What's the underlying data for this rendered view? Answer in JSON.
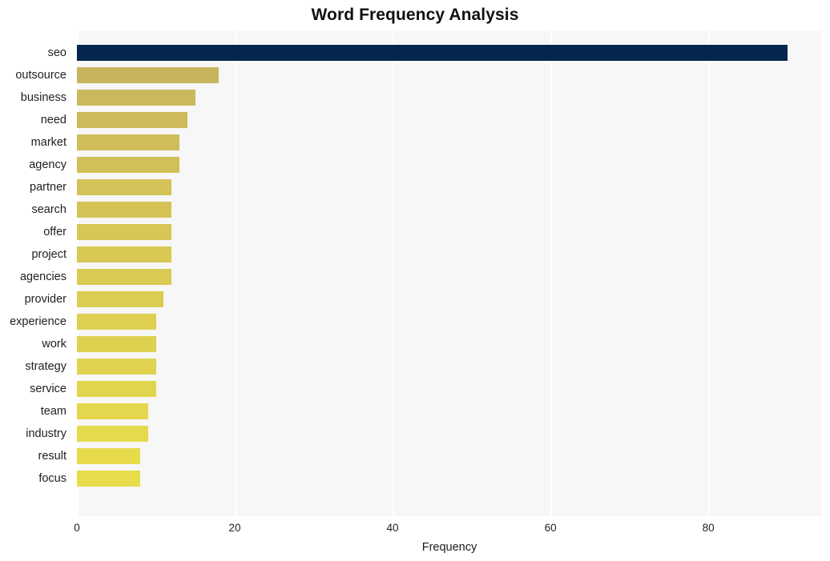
{
  "chart_data": {
    "type": "bar",
    "orientation": "horizontal",
    "title": "Word Frequency Analysis",
    "xlabel": "Frequency",
    "ylabel": "",
    "categories": [
      "seo",
      "outsource",
      "business",
      "need",
      "market",
      "agency",
      "partner",
      "search",
      "offer",
      "project",
      "agencies",
      "provider",
      "experience",
      "work",
      "strategy",
      "service",
      "team",
      "industry",
      "result",
      "focus"
    ],
    "values": [
      90,
      18,
      15,
      14,
      13,
      13,
      12,
      12,
      12,
      12,
      12,
      11,
      10,
      10,
      10,
      10,
      9,
      9,
      8,
      8
    ],
    "xlim": [
      0,
      94.4
    ],
    "xticks": [
      0,
      20,
      40,
      60,
      80
    ],
    "xtick_labels": [
      "0",
      "20",
      "40",
      "60",
      "80"
    ],
    "grid": true,
    "grid_axis": "x",
    "legend": false,
    "bar_colors": [
      "#04254d",
      "#c7b45f",
      "#cbb85c",
      "#ceba5a",
      "#d0bd59",
      "#d2bf58",
      "#d4c157",
      "#d6c356",
      "#d8c655",
      "#d9c854",
      "#dbca53",
      "#dccc52",
      "#decf51",
      "#dfd150",
      "#e1d34f",
      "#e2d54e",
      "#e4d74d",
      "#e5d94c",
      "#e7db4b",
      "#e8dc4a"
    ],
    "plot_background": "#f7f7f7",
    "figure_background": "#ffffff",
    "gridline_color": "#ffffff",
    "highlight_color": "#04254d"
  }
}
